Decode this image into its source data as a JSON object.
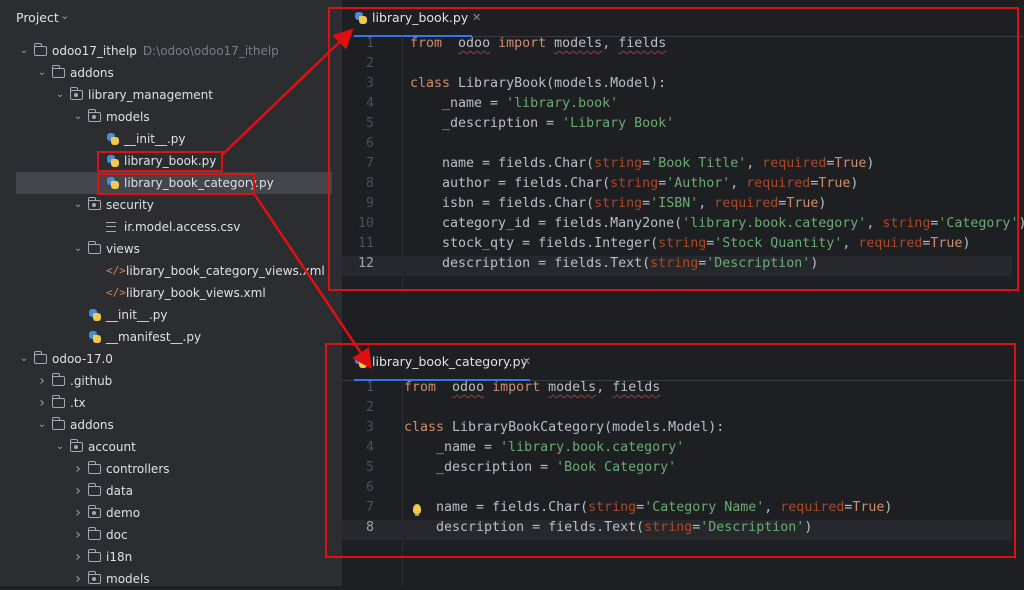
{
  "project_panel": {
    "title": "Project",
    "tree": [
      {
        "label": "odoo17_ithelp",
        "path": "D:\\odoo\\odoo17_ithelp",
        "type": "folder",
        "expanded": true
      },
      {
        "label": "addons",
        "type": "folder",
        "expanded": true
      },
      {
        "label": "library_management",
        "type": "package",
        "expanded": true
      },
      {
        "label": "models",
        "type": "package",
        "expanded": true
      },
      {
        "label": "__init__.py",
        "type": "python"
      },
      {
        "label": "library_book.py",
        "type": "python"
      },
      {
        "label": "library_book_category.py",
        "type": "python",
        "selected": true
      },
      {
        "label": "security",
        "type": "package",
        "expanded": true
      },
      {
        "label": "ir.model.access.csv",
        "type": "text"
      },
      {
        "label": "views",
        "type": "folder",
        "expanded": true
      },
      {
        "label": "library_book_category_views.xml",
        "type": "xml"
      },
      {
        "label": "library_book_views.xml",
        "type": "xml"
      },
      {
        "label": "__init__.py",
        "type": "python"
      },
      {
        "label": "__manifest__.py",
        "type": "python"
      },
      {
        "label": "odoo-17.0",
        "type": "folder",
        "expanded": true
      },
      {
        "label": ".github",
        "type": "folder",
        "expanded": false
      },
      {
        "label": ".tx",
        "type": "folder",
        "expanded": false
      },
      {
        "label": "addons",
        "type": "folder",
        "expanded": true
      },
      {
        "label": "account",
        "type": "package",
        "expanded": true
      },
      {
        "label": "controllers",
        "type": "folder",
        "expanded": false
      },
      {
        "label": "data",
        "type": "folder",
        "expanded": false
      },
      {
        "label": "demo",
        "type": "package",
        "expanded": false
      },
      {
        "label": "doc",
        "type": "folder",
        "expanded": false
      },
      {
        "label": "i18n",
        "type": "folder",
        "expanded": false
      },
      {
        "label": "models",
        "type": "package",
        "expanded": false
      }
    ]
  },
  "editor_top": {
    "tab_label": "library_book.py",
    "current_line": 12,
    "lines": [
      [
        [
          "kw",
          "from"
        ],
        [
          "",
          "  "
        ],
        [
          "wavy",
          "odoo"
        ],
        [
          "",
          " "
        ],
        [
          "kw",
          "import"
        ],
        [
          "",
          " "
        ],
        [
          "wavy",
          "models"
        ],
        [
          "",
          ", "
        ],
        [
          "wavy",
          "fields"
        ]
      ],
      [],
      [
        [
          "kw",
          "class"
        ],
        [
          "",
          " LibraryBook(models.Model):"
        ]
      ],
      [
        [
          "",
          "    _name = "
        ],
        [
          "str",
          "'library.book'"
        ]
      ],
      [
        [
          "",
          "    _description = "
        ],
        [
          "str",
          "'Library Book'"
        ]
      ],
      [],
      [
        [
          "",
          "    name = fields.Char("
        ],
        [
          "par",
          "string"
        ],
        [
          "",
          "="
        ],
        [
          "str",
          "'Book Title'"
        ],
        [
          "",
          ", "
        ],
        [
          "par",
          "required"
        ],
        [
          "",
          "="
        ],
        [
          "kw",
          "True"
        ],
        [
          "",
          ")"
        ]
      ],
      [
        [
          "",
          "    author = fields.Char("
        ],
        [
          "par",
          "string"
        ],
        [
          "",
          "="
        ],
        [
          "str",
          "'Author'"
        ],
        [
          "",
          ", "
        ],
        [
          "par",
          "required"
        ],
        [
          "",
          "="
        ],
        [
          "kw",
          "True"
        ],
        [
          "",
          ")"
        ]
      ],
      [
        [
          "",
          "    isbn = fields.Char("
        ],
        [
          "par",
          "string"
        ],
        [
          "",
          "="
        ],
        [
          "str",
          "'ISBN'"
        ],
        [
          "",
          ", "
        ],
        [
          "par",
          "required"
        ],
        [
          "",
          "="
        ],
        [
          "kw",
          "True"
        ],
        [
          "",
          ")"
        ]
      ],
      [
        [
          "",
          "    category_id = fields.Many2one("
        ],
        [
          "str",
          "'library.book.category'"
        ],
        [
          "",
          ", "
        ],
        [
          "par",
          "string"
        ],
        [
          "",
          "="
        ],
        [
          "str",
          "'Category'"
        ],
        [
          "",
          ")"
        ]
      ],
      [
        [
          "",
          "    stock_qty = fields.Integer("
        ],
        [
          "par",
          "string"
        ],
        [
          "",
          "="
        ],
        [
          "str",
          "'Stock Quantity'"
        ],
        [
          "",
          ", "
        ],
        [
          "par",
          "required"
        ],
        [
          "",
          "="
        ],
        [
          "kw",
          "True"
        ],
        [
          "",
          ")"
        ]
      ],
      [
        [
          "",
          "    description = fields.Text("
        ],
        [
          "par",
          "string"
        ],
        [
          "",
          "="
        ],
        [
          "str",
          "'Description'"
        ],
        [
          "",
          ")"
        ]
      ]
    ]
  },
  "editor_bottom": {
    "tab_label": "library_book_category.py",
    "current_line": 8,
    "lines": [
      [
        [
          "kw",
          "from"
        ],
        [
          "",
          "  "
        ],
        [
          "wavy",
          "odoo"
        ],
        [
          "",
          " "
        ],
        [
          "kw",
          "import"
        ],
        [
          "",
          " "
        ],
        [
          "wavy",
          "models"
        ],
        [
          "",
          ", "
        ],
        [
          "wavy",
          "fields"
        ]
      ],
      [],
      [
        [
          "kw",
          "class"
        ],
        [
          "",
          " LibraryBookCategory(models.Model):"
        ]
      ],
      [
        [
          "",
          "    _name = "
        ],
        [
          "str",
          "'library.book.category'"
        ]
      ],
      [
        [
          "",
          "    _description = "
        ],
        [
          "str",
          "'Book Category'"
        ]
      ],
      [],
      [
        [
          "",
          "    name = fields.Char("
        ],
        [
          "par",
          "string"
        ],
        [
          "",
          "="
        ],
        [
          "str",
          "'Category Name'"
        ],
        [
          "",
          ", "
        ],
        [
          "par",
          "required"
        ],
        [
          "",
          "="
        ],
        [
          "kw",
          "True"
        ],
        [
          "",
          ")"
        ]
      ],
      [
        [
          "",
          "    description = fields.Text("
        ],
        [
          "par",
          "string"
        ],
        [
          "",
          "="
        ],
        [
          "str",
          "'Description'"
        ],
        [
          "",
          ")"
        ]
      ]
    ]
  }
}
